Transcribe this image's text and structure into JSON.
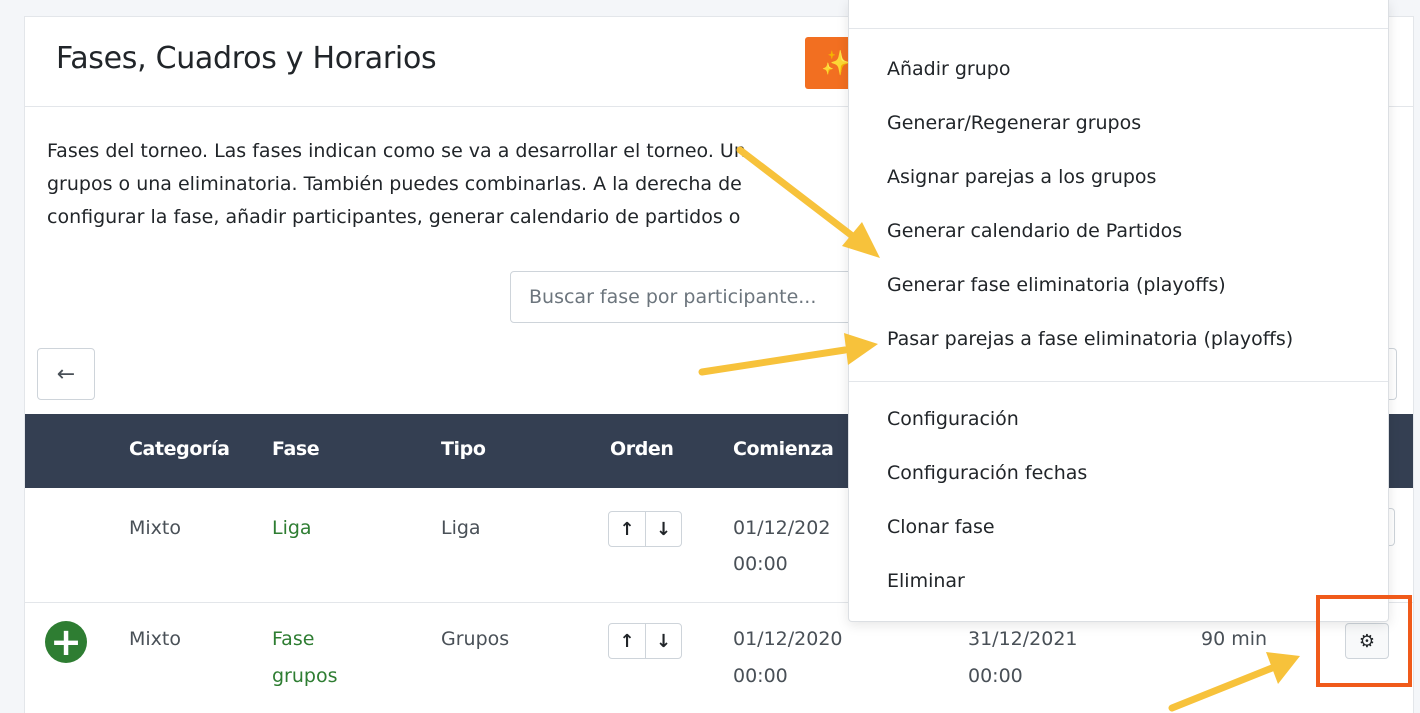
{
  "header": {
    "title": "Fases, Cuadros y Horarios",
    "wand_icon": "magic-wand-icon"
  },
  "intro": {
    "line1": "Fases del torneo. Las fases indican como se va a desarrollar el torneo. Un",
    "line2": "grupos o una eliminatoria. También puedes combinarlas. A la derecha de",
    "line3": "configurar la fase, añadir participantes, generar calendario de partidos o"
  },
  "search": {
    "placeholder": "Buscar fase por participante..."
  },
  "table": {
    "headers": {
      "categoria": "Categoría",
      "fase": "Fase",
      "tipo": "Tipo",
      "orden": "Orden",
      "comienza": "Comienza"
    },
    "rows": [
      {
        "categoria": "Mixto",
        "fase_l1": "Liga",
        "fase_l2": "",
        "tipo": "Liga",
        "comienza_l1": "01/12/202",
        "comienza_l2": "00:00"
      },
      {
        "categoria": "Mixto",
        "fase_l1": "Fase",
        "fase_l2": "grupos",
        "tipo": "Grupos",
        "comienza_l1": "01/12/2020",
        "comienza_l2": "00:00",
        "termina_l1": "31/12/2021",
        "termina_l2": "00:00",
        "duracion": "90 min"
      }
    ]
  },
  "dropdown": {
    "items": [
      "Añadir grupo",
      "Generar/Regenerar grupos",
      "Asignar parejas a los grupos",
      "Generar calendario de Partidos",
      "Generar fase eliminatoria (playoffs)",
      "Pasar parejas a fase eliminatoria (playoffs)",
      "Configuración",
      "Configuración fechas",
      "Clonar fase",
      "Eliminar"
    ]
  },
  "colors": {
    "brand_orange": "#f26f21",
    "header_dark": "#343f52",
    "link_green": "#2e7d32",
    "annotation_yellow": "#f7c23b",
    "highlight_orange": "#f05a1a"
  }
}
